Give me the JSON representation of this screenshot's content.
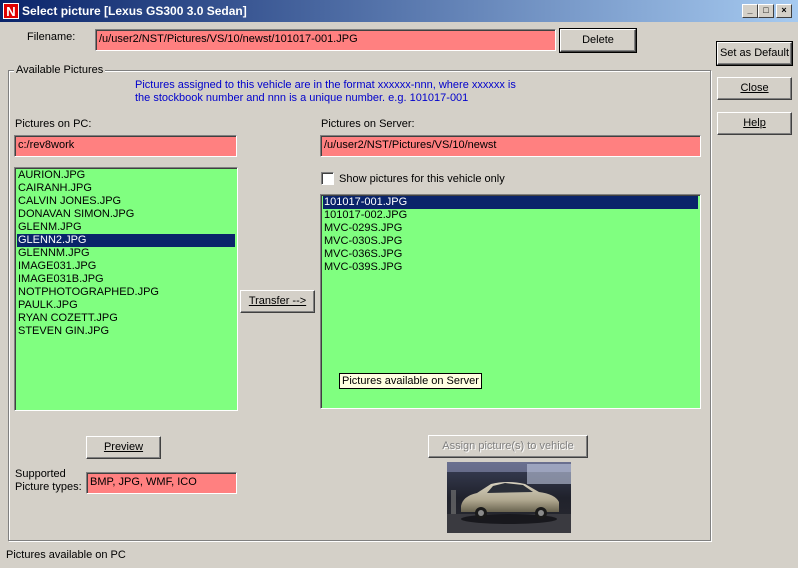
{
  "window": {
    "title": "Select picture [Lexus GS300 3.0 Sedan]",
    "icon_letter": "N",
    "controls": {
      "minimize": "_",
      "maximize": "□",
      "close": "×"
    }
  },
  "filename": {
    "label": "Filename:",
    "value": "/u/user2/NST/Pictures/VS/10/newst/101017-001.JPG"
  },
  "buttons": {
    "delete": "Delete",
    "set_default": "Set as Default",
    "close": "Close",
    "help": "Help",
    "transfer": "Transfer -->",
    "preview": "Preview",
    "assign": "Assign picture(s) to vehicle"
  },
  "available": {
    "group_title": "Available Pictures",
    "info_line1": "Pictures assigned to this vehicle are in the format xxxxxx-nnn, where xxxxxx is",
    "info_line2": "the stockbook number and nnn is a unique number. e.g. 101017-001"
  },
  "pc": {
    "label": "Pictures on PC:",
    "path": "c:/rev8work",
    "files": [
      "AURION.JPG",
      "CAIRANH.JPG",
      "CALVIN JONES.JPG",
      "DONAVAN SIMON.JPG",
      "GLENM.JPG",
      "GLENN2.JPG",
      "GLENNM.JPG",
      "IMAGE031.JPG",
      "IMAGE031B.JPG",
      "NOTPHOTOGRAPHED.JPG",
      "PAULK.JPG",
      "RYAN COZETT.JPG",
      "STEVEN GIN.JPG"
    ],
    "selected_index": 5
  },
  "server": {
    "label": "Pictures on Server:",
    "path": "/u/user2/NST/Pictures/VS/10/newst",
    "checkbox_label": "Show pictures for this vehicle only",
    "checkbox_checked": false,
    "files": [
      "101017-001.JPG",
      "101017-002.JPG",
      "MVC-029S.JPG",
      "MVC-030S.JPG",
      "MVC-036S.JPG",
      "MVC-039S.JPG"
    ],
    "selected_index": 0,
    "tooltip": "Pictures available on Server"
  },
  "supported": {
    "label_line1": "Supported",
    "label_line2": "Picture types:",
    "value": "BMP, JPG, WMF, ICO"
  },
  "status": "Pictures available on PC",
  "colors": {
    "field_pink": "#ff8080",
    "list_green": "#80ff80",
    "selection": "#0a246a",
    "info_blue": "#0000cc"
  }
}
